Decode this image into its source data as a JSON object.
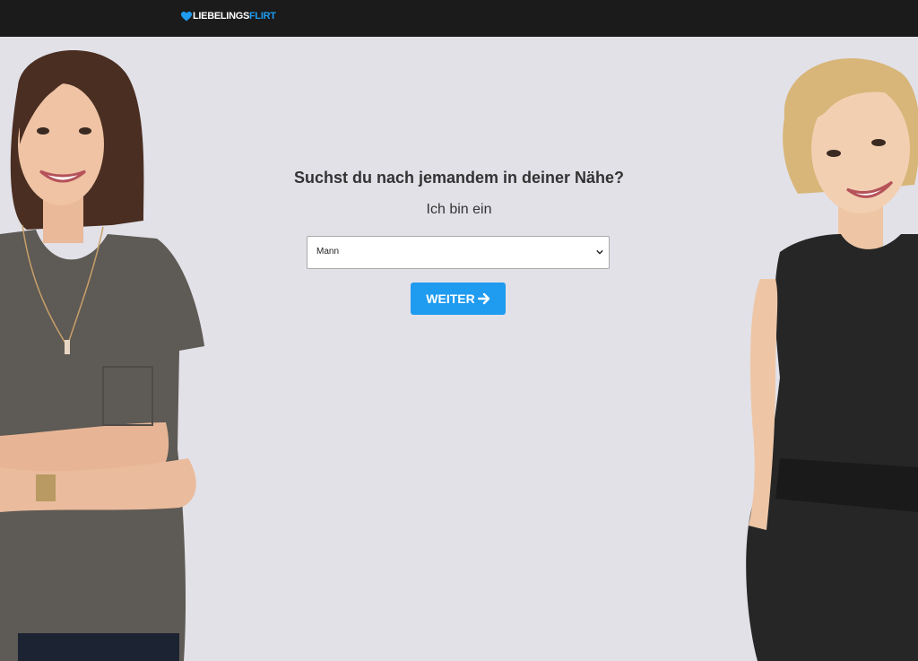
{
  "header": {
    "logo_part1": "LIEBELINGS",
    "logo_part2": "FLIRT",
    "logo_icon": "heart-icon"
  },
  "colors": {
    "accent": "#1f9bf0",
    "header_bg": "#1b1b1b",
    "page_bg": "#e2e1e8",
    "text": "#333333"
  },
  "main": {
    "headline": "Suchst du nach jemandem in deiner Nähe?",
    "subline": "Ich bin ein",
    "gender_select": {
      "selected": "Mann",
      "icon": "chevron-down-icon"
    },
    "continue_button": {
      "label": "WEITER",
      "icon": "arrow-right-icon"
    }
  }
}
